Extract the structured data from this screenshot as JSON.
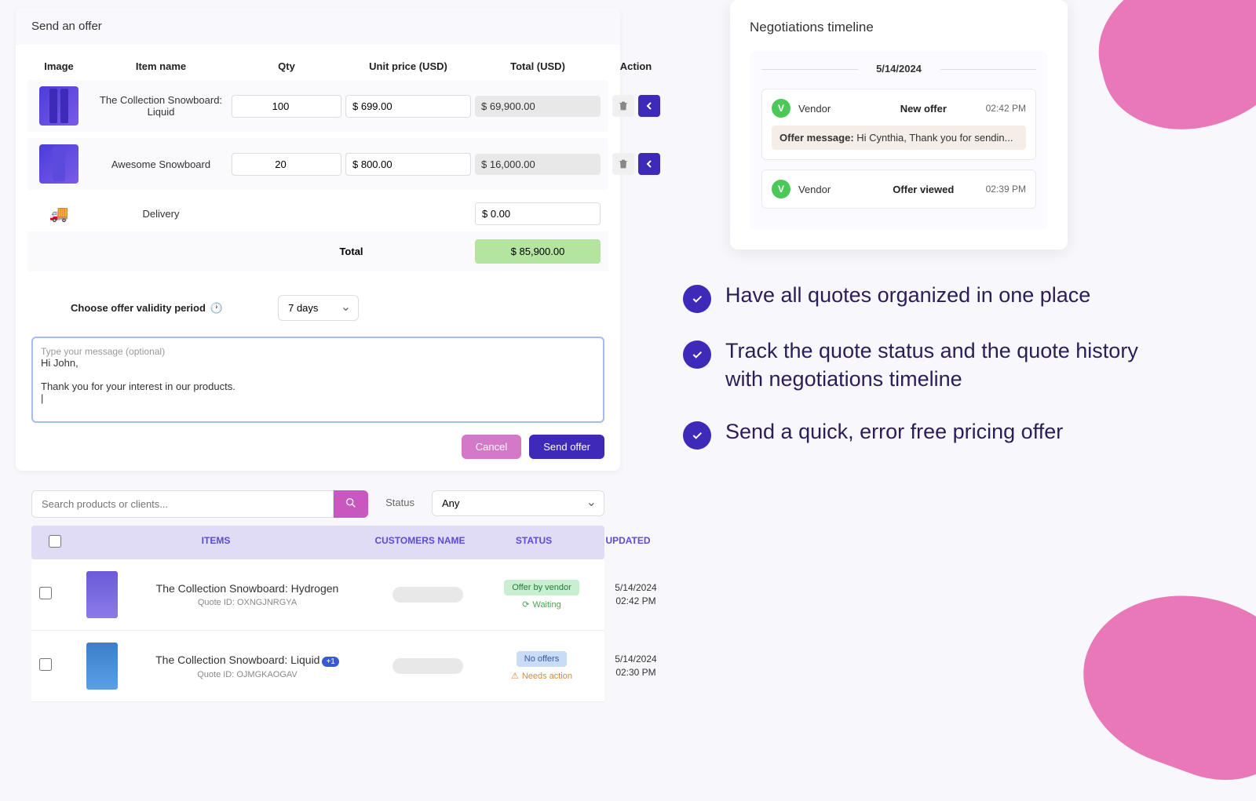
{
  "offer_panel": {
    "title": "Send an offer",
    "columns": {
      "image": "Image",
      "name": "Item name",
      "qty": "Qty",
      "unit": "Unit price (USD)",
      "total": "Total (USD)",
      "action": "Action"
    },
    "items": [
      {
        "name": "The Collection Snowboard: Liquid",
        "qty": "100",
        "unit_price": "$ 699.00",
        "total": "$ 69,900.00"
      },
      {
        "name": "Awesome Snowboard",
        "qty": "20",
        "unit_price": "$ 800.00",
        "total": "$ 16,000.00"
      }
    ],
    "delivery_label": "Delivery",
    "delivery_value": "$ 0.00",
    "total_label": "Total",
    "grand_total": "$ 85,900.00",
    "validity_label": "Choose offer validity period",
    "validity_value": "7 days",
    "message_placeholder": "Type your message (optional)",
    "message_text": "Hi John,\n\nThank you for your interest in our products.\n|",
    "cancel": "Cancel",
    "send": "Send offer"
  },
  "search": {
    "placeholder": "Search products or clients...",
    "status_label": "Status",
    "status_value": "Any"
  },
  "quotes": {
    "columns": {
      "items": "ITEMS",
      "customer": "CUSTOMERS NAME",
      "status": "STATUS",
      "updated": "UPDATED"
    },
    "rows": [
      {
        "name": "The Collection Snowboard: Hydrogen",
        "quote_id": "Quote ID: OXNGJNRGYA",
        "badge": "Offer by vendor",
        "sub": "Waiting",
        "updated_date": "5/14/2024",
        "updated_time": "02:42 PM",
        "plus": ""
      },
      {
        "name": "The Collection Snowboard: Liquid",
        "quote_id": "Quote ID: OJMGKAOGAV",
        "badge": "No offers",
        "sub": "Needs action",
        "updated_date": "5/14/2024",
        "updated_time": "02:30 PM",
        "plus": "+1"
      }
    ]
  },
  "timeline": {
    "title": "Negotiations timeline",
    "date": "5/14/2024",
    "items": [
      {
        "who": "Vendor",
        "event": "New offer",
        "time": "02:42 PM",
        "msg_label": "Offer message:",
        "msg": "Hi Cynthia, Thank you for sendin..."
      },
      {
        "who": "Vendor",
        "event": "Offer viewed",
        "time": "02:39 PM"
      }
    ]
  },
  "benefits": [
    "Have all quotes organized in one place",
    "Track the quote status and the quote history with negotiations timeline",
    "Send a quick, error free pricing offer"
  ]
}
